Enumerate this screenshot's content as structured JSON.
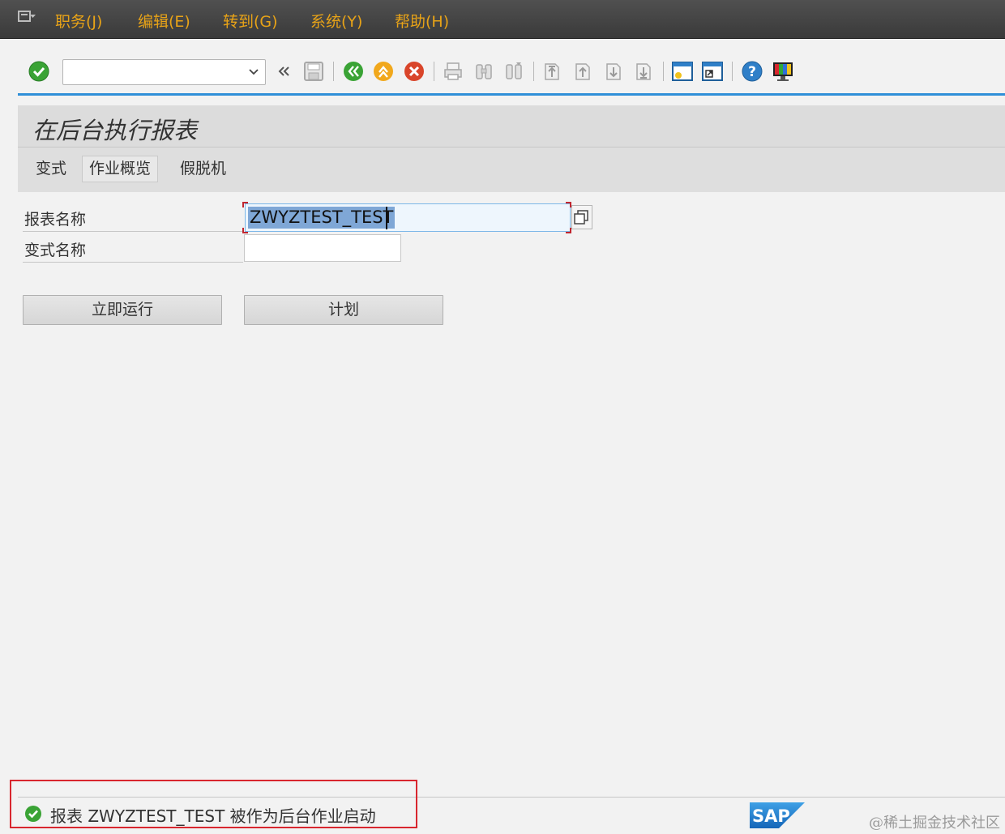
{
  "menubar": {
    "items": [
      "职务(J)",
      "编辑(E)",
      "转到(G)",
      "系统(Y)",
      "帮助(H)"
    ]
  },
  "toolbar": {
    "command_field_value": ""
  },
  "page": {
    "title": "在后台执行报表"
  },
  "app_toolbar": {
    "items": [
      "变式",
      "作业概览",
      "假脱机"
    ]
  },
  "form": {
    "report_name_label": "报表名称",
    "report_name_value": "ZWYZTEST_TEST",
    "variant_name_label": "变式名称",
    "variant_name_value": ""
  },
  "buttons": {
    "run_now": "立即运行",
    "schedule": "计划"
  },
  "status": {
    "message": "报表 ZWYZTEST_TEST 被作为后台作业启动",
    "type": "success"
  },
  "brand": {
    "logo_text": "SAP",
    "watermark": "@稀土掘金技术社区"
  },
  "colors": {
    "menu_text": "#e8a317",
    "accent_line": "#2f8fd8",
    "success": "#3aa335",
    "highlight_border": "#d8262e"
  }
}
